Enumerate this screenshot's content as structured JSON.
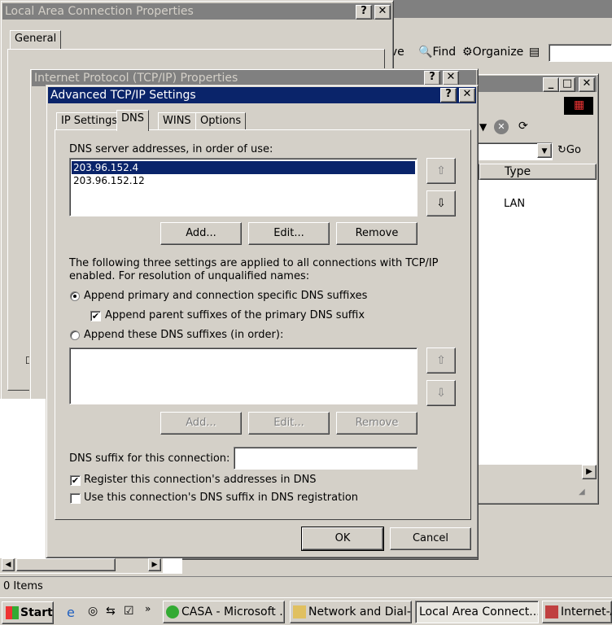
{
  "bg_window": {
    "toolbar": {
      "move_label": "ive",
      "find_label": "Find",
      "organize_label": "Organize"
    },
    "address_go": "Go",
    "column_type": "Type",
    "row_type": "LAN"
  },
  "lac_window": {
    "title": "Local Area Connection Properties",
    "tab_general": "General"
  },
  "tcpip_window": {
    "title": "Internet Protocol (TCP/IP) Properties"
  },
  "dialog": {
    "title": "Advanced TCP/IP Settings",
    "tabs": [
      "IP Settings",
      "DNS",
      "WINS",
      "Options"
    ],
    "dns_servers_label": "DNS server addresses, in order of use:",
    "dns_servers": [
      "203.96.152.4",
      "203.96.152.12"
    ],
    "add_label": "Add...",
    "edit_label": "Edit...",
    "remove_label": "Remove",
    "info_line1": "The following three settings are applied to all connections with TCP/IP",
    "info_line2": "enabled. For resolution of unqualified names:",
    "radio_primary": "Append primary and connection specific DNS suffixes",
    "check_parent": "Append parent suffixes of the primary DNS suffix",
    "radio_these": "Append these DNS suffixes (in order):",
    "suffix_add": "Add...",
    "suffix_edit": "Edit...",
    "suffix_remove": "Remove",
    "dns_suffix_label": "DNS suffix for this connection:",
    "dns_suffix_value": "",
    "check_register": "Register this connection's addresses in DNS",
    "check_use_suffix": "Use this connection's DNS suffix in DNS registration",
    "ok_label": "OK",
    "cancel_label": "Cancel"
  },
  "status_bar": "0 Items",
  "taskbar": {
    "start": "Start",
    "tasks": [
      "CASA - Microsoft ...",
      "Network and Dial-...",
      "Local Area Connect...",
      "Internet-A"
    ]
  }
}
